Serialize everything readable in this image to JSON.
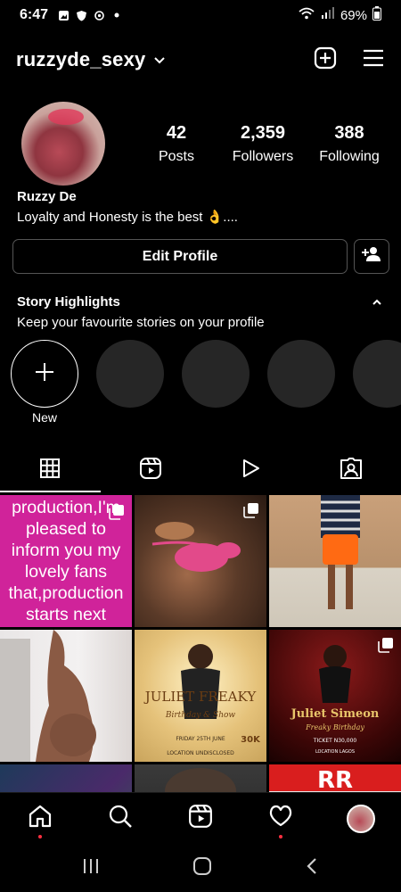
{
  "status": {
    "time": "6:47",
    "battery": "69%"
  },
  "header": {
    "username": "ruzzyde_sexy"
  },
  "profile": {
    "stats": [
      {
        "num": "42",
        "label": "Posts"
      },
      {
        "num": "2,359",
        "label": "Followers"
      },
      {
        "num": "388",
        "label": "Following"
      }
    ],
    "name": "Ruzzy De",
    "bio": "Loyalty and Honesty is the best 👌...."
  },
  "actions": {
    "edit_label": "Edit Profile"
  },
  "highlights": {
    "title": "Story Highlights",
    "subtitle": "Keep your favourite stories on your profile",
    "new_label": "New"
  },
  "posts": {
    "p1_text": "production,I'm pleased to inform you my lovely fans that,production starts next",
    "p5_title": "JULIET FREAKY",
    "p5_sub": "Birthday & Show",
    "p5_date": "FRIDAY 25TH JUNE",
    "p5_loc": "LOCATION UNDISCLOSED",
    "p5_price": "30K",
    "p6_title": "Juliet Simeon",
    "p6_sub": "Freaky Birthday",
    "p6_ticket": "TICKET N30,000",
    "p6_loc": "LOCATION LAGOS",
    "p9_text": "RR"
  },
  "colors": {
    "accent_pink": "#d0239a",
    "notification_dot": "#ff3040",
    "orange": "#ff6a13"
  }
}
